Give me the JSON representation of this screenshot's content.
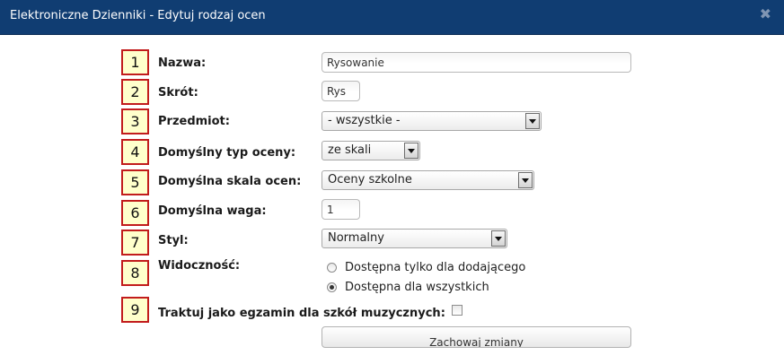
{
  "window": {
    "title": "Elektroniczne Dzienniki - Edytuj rodzaj ocen",
    "close_glyph": "✖"
  },
  "badges": [
    "1",
    "2",
    "3",
    "4",
    "5",
    "6",
    "7",
    "8",
    "9"
  ],
  "form": {
    "name": {
      "label": "Nazwa:",
      "value": "Rysowanie"
    },
    "short": {
      "label": "Skrót:",
      "value": "Rys"
    },
    "subject": {
      "label": "Przedmiot:",
      "value": "- wszystkie -"
    },
    "grade_type": {
      "label": "Domyślny typ oceny:",
      "value": "ze skali"
    },
    "scale": {
      "label": "Domyślna skala ocen:",
      "value": "Oceny szkolne"
    },
    "weight": {
      "label": "Domyślna waga:",
      "value": "1"
    },
    "style": {
      "label": "Styl:",
      "value": "Normalny"
    },
    "visibility": {
      "label": "Widoczność:",
      "options": [
        {
          "label": "Dostępna tylko dla dodającego",
          "checked": false
        },
        {
          "label": "Dostępna dla wszystkich",
          "checked": true
        }
      ]
    },
    "exam": {
      "label": "Traktuj jako egzamin dla szkół muzycznych:",
      "checked": false
    },
    "submit_label": "Zachowaj zmiany"
  },
  "colors": {
    "titlebar": "#103d72",
    "badge_border": "#c21c1c",
    "badge_fill": "#ffffcc"
  }
}
